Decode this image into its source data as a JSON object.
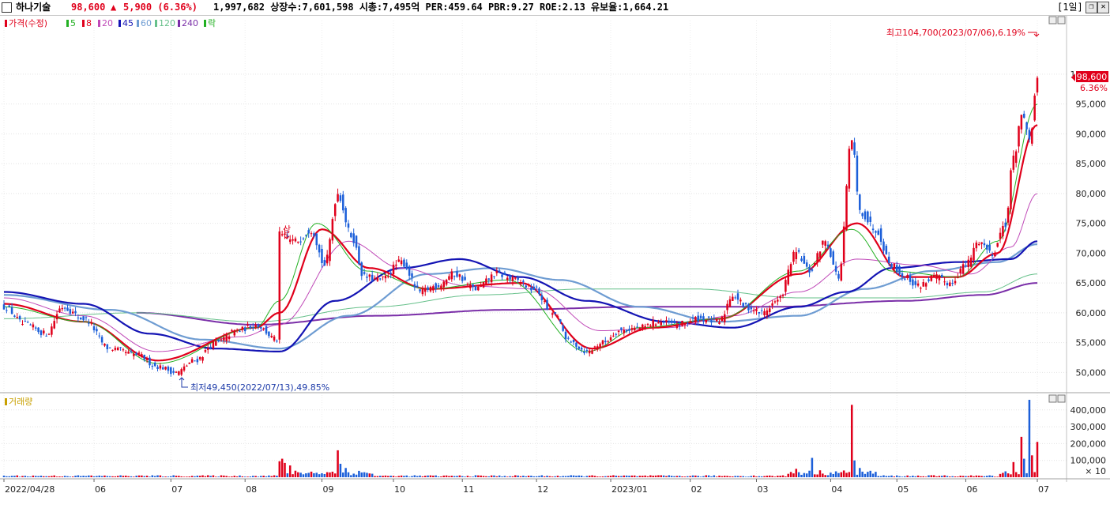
{
  "header": {
    "stock_name": "하나기술",
    "price": "98,600",
    "change_arrow": "▲",
    "change": "5,900 (6.36%)",
    "stats": "1,997,682  상장수:7,601,598 시총:7,495억 PER:459.64 PBR:9.27 ROE:2.13 유보율:1,664.21",
    "period": "[1일]",
    "btn_restore": "❐",
    "btn_close": "✕"
  },
  "colors": {
    "up": "#e0001b",
    "down": "#1c5fd9",
    "ma5": "#22b022",
    "ma8": "#e0001b",
    "ma20": "#c04ab8",
    "ma45": "#1414b4",
    "ma60": "#6e9cd2",
    "ma120": "#66c08a",
    "ma240": "#7a2ea8"
  },
  "legend": {
    "price": [
      {
        "label": "가격(수정)",
        "color": "#e0001b"
      },
      {
        "label": "5",
        "color": "#22b022"
      },
      {
        "label": "8",
        "color": "#e0001b"
      },
      {
        "label": "20",
        "color": "#c04ab8"
      },
      {
        "label": "45",
        "color": "#1414b4"
      },
      {
        "label": "60",
        "color": "#6e9cd2"
      },
      {
        "label": "120",
        "color": "#66c08a"
      },
      {
        "label": "240",
        "color": "#7a2ea8"
      },
      {
        "label": "락",
        "color": "#22b022"
      }
    ],
    "volume": [
      {
        "label": "거래량",
        "color": "#c8a000"
      }
    ]
  },
  "annotations": {
    "high": "최고104,700(2023/07/06),6.19%",
    "low": "최저49,450(2022/07/13),49.85%",
    "limit_up": "상",
    "current_price": "98,600",
    "current_pct": "6.36%",
    "volume_unit": "× 10"
  },
  "chart_data": [
    {
      "type": "candlestick",
      "title": "",
      "y_ticks": [
        50000,
        55000,
        60000,
        65000,
        70000,
        75000,
        80000,
        85000,
        90000,
        95000,
        100000
      ],
      "y_tick_labels": [
        "50,000",
        "55,000",
        "60,000",
        "65,000",
        "70,000",
        "75,000",
        "80,000",
        "85,000",
        "90,000",
        "95,000",
        "100,000"
      ],
      "ylim": [
        47000,
        109000
      ],
      "x_labels": [
        "2022/04/28",
        "06",
        "07",
        "08",
        "09",
        "10",
        "11",
        "12",
        "2023/01",
        "02",
        "03",
        "04",
        "05",
        "06",
        "07"
      ],
      "close_keypoints": [
        [
          0,
          61000
        ],
        [
          8,
          58000
        ],
        [
          16,
          56500
        ],
        [
          22,
          61000
        ],
        [
          30,
          59000
        ],
        [
          40,
          54000
        ],
        [
          50,
          53000
        ],
        [
          58,
          51000
        ],
        [
          65,
          50000
        ],
        [
          72,
          52000
        ],
        [
          80,
          55000
        ],
        [
          88,
          57000
        ],
        [
          95,
          58000
        ],
        [
          103,
          55500
        ],
        [
          104,
          73000
        ],
        [
          110,
          72000
        ],
        [
          116,
          74000
        ],
        [
          121,
          68000
        ],
        [
          126,
          80000
        ],
        [
          131,
          73000
        ],
        [
          136,
          66000
        ],
        [
          142,
          65500
        ],
        [
          150,
          68500
        ],
        [
          157,
          63500
        ],
        [
          163,
          64500
        ],
        [
          170,
          66500
        ],
        [
          178,
          64000
        ],
        [
          186,
          66500
        ],
        [
          193,
          65500
        ],
        [
          200,
          64000
        ],
        [
          207,
          60000
        ],
        [
          214,
          55000
        ],
        [
          220,
          53500
        ],
        [
          226,
          55000
        ],
        [
          232,
          57000
        ],
        [
          240,
          57500
        ],
        [
          247,
          58500
        ],
        [
          254,
          58000
        ],
        [
          262,
          59000
        ],
        [
          270,
          58500
        ],
        [
          275,
          63000
        ],
        [
          280,
          61000
        ],
        [
          286,
          60000
        ],
        [
          292,
          62000
        ],
        [
          299,
          70000
        ],
        [
          304,
          67000
        ],
        [
          310,
          72000
        ],
        [
          315,
          66000
        ],
        [
          320,
          89000
        ],
        [
          323,
          77000
        ],
        [
          329,
          74000
        ],
        [
          335,
          68000
        ],
        [
          340,
          66000
        ],
        [
          345,
          64500
        ],
        [
          351,
          66000
        ],
        [
          357,
          65000
        ],
        [
          363,
          68000
        ],
        [
          368,
          72000
        ],
        [
          373,
          70000
        ],
        [
          378,
          75000
        ],
        [
          381,
          86000
        ],
        [
          384,
          93000
        ],
        [
          387,
          89000
        ],
        [
          390,
          98600
        ]
      ],
      "ma_keypoints": {
        "ma5": [
          [
            0,
            61000
          ],
          [
            30,
            58500
          ],
          [
            58,
            51500
          ],
          [
            95,
            57500
          ],
          [
            104,
            62000
          ],
          [
            118,
            75000
          ],
          [
            137,
            67000
          ],
          [
            160,
            64000
          ],
          [
            190,
            65500
          ],
          [
            220,
            53500
          ],
          [
            240,
            57500
          ],
          [
            270,
            59000
          ],
          [
            300,
            67000
          ],
          [
            320,
            74000
          ],
          [
            335,
            67000
          ],
          [
            360,
            66000
          ],
          [
            375,
            72000
          ],
          [
            390,
            95000
          ]
        ],
        "ma8": [
          [
            0,
            61500
          ],
          [
            30,
            58500
          ],
          [
            58,
            52000
          ],
          [
            95,
            57500
          ],
          [
            104,
            60000
          ],
          [
            120,
            74000
          ],
          [
            138,
            67500
          ],
          [
            160,
            64000
          ],
          [
            195,
            65000
          ],
          [
            222,
            54000
          ],
          [
            245,
            57500
          ],
          [
            270,
            59000
          ],
          [
            300,
            66500
          ],
          [
            322,
            75000
          ],
          [
            340,
            66000
          ],
          [
            360,
            66000
          ],
          [
            375,
            70000
          ],
          [
            390,
            91500
          ]
        ],
        "ma20": [
          [
            0,
            62500
          ],
          [
            30,
            59500
          ],
          [
            58,
            53500
          ],
          [
            90,
            56000
          ],
          [
            104,
            58000
          ],
          [
            130,
            72000
          ],
          [
            150,
            67500
          ],
          [
            175,
            64500
          ],
          [
            200,
            64000
          ],
          [
            225,
            57000
          ],
          [
            250,
            57500
          ],
          [
            275,
            59500
          ],
          [
            300,
            63500
          ],
          [
            322,
            69000
          ],
          [
            345,
            68000
          ],
          [
            365,
            66500
          ],
          [
            380,
            71000
          ],
          [
            390,
            80000
          ]
        ],
        "ma45": [
          [
            0,
            63500
          ],
          [
            30,
            61500
          ],
          [
            55,
            56500
          ],
          [
            80,
            54000
          ],
          [
            104,
            53500
          ],
          [
            125,
            62000
          ],
          [
            150,
            67500
          ],
          [
            172,
            69000
          ],
          [
            195,
            66000
          ],
          [
            220,
            62000
          ],
          [
            250,
            58500
          ],
          [
            275,
            57500
          ],
          [
            300,
            61000
          ],
          [
            318,
            63500
          ],
          [
            335,
            67500
          ],
          [
            360,
            68500
          ],
          [
            380,
            69000
          ],
          [
            390,
            72000
          ]
        ],
        "ma60": [
          [
            0,
            63000
          ],
          [
            40,
            60500
          ],
          [
            75,
            55500
          ],
          [
            104,
            54000
          ],
          [
            130,
            59500
          ],
          [
            160,
            66500
          ],
          [
            185,
            67500
          ],
          [
            210,
            65500
          ],
          [
            240,
            61000
          ],
          [
            270,
            58500
          ],
          [
            300,
            59500
          ],
          [
            325,
            64000
          ],
          [
            350,
            67000
          ],
          [
            375,
            68500
          ],
          [
            390,
            71500
          ]
        ],
        "ma120": [
          [
            0,
            59000
          ],
          [
            50,
            60000
          ],
          [
            95,
            58500
          ],
          [
            140,
            61000
          ],
          [
            180,
            63000
          ],
          [
            220,
            64000
          ],
          [
            260,
            64000
          ],
          [
            300,
            62500
          ],
          [
            340,
            62500
          ],
          [
            370,
            63500
          ],
          [
            390,
            66500
          ]
        ],
        "ma240": [
          [
            50,
            60000
          ],
          [
            95,
            58000
          ],
          [
            140,
            59500
          ],
          [
            190,
            60500
          ],
          [
            240,
            61000
          ],
          [
            290,
            61000
          ],
          [
            340,
            62000
          ],
          [
            370,
            63000
          ],
          [
            390,
            65000
          ]
        ]
      }
    },
    {
      "type": "bar",
      "title": "",
      "y_ticks": [
        100000,
        200000,
        300000,
        400000
      ],
      "y_tick_labels": [
        "100,000",
        "200,000",
        "300,000",
        "400,000"
      ],
      "ylim": [
        0,
        460000
      ],
      "spikes": [
        [
          104,
          95000
        ],
        [
          105,
          110000
        ],
        [
          106,
          85000
        ],
        [
          108,
          70000
        ],
        [
          126,
          160000
        ],
        [
          127,
          80000
        ],
        [
          129,
          55000
        ],
        [
          299,
          50000
        ],
        [
          305,
          115000
        ],
        [
          320,
          430000
        ],
        [
          321,
          100000
        ],
        [
          323,
          55000
        ],
        [
          381,
          90000
        ],
        [
          384,
          240000
        ],
        [
          385,
          110000
        ],
        [
          387,
          460000
        ],
        [
          388,
          130000
        ],
        [
          390,
          210000
        ]
      ]
    }
  ]
}
